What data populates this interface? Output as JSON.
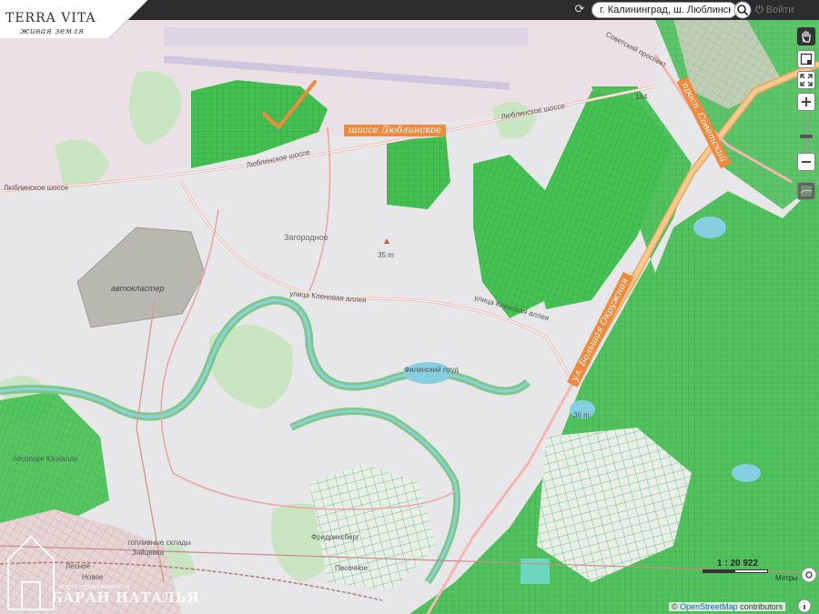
{
  "app": {
    "logo_title": "TERRA VITA",
    "logo_subtitle": "живая земля"
  },
  "header": {
    "search_value": "г. Калининград, ш. Люблинское, ",
    "logout_label": "Войти"
  },
  "map_labels": {
    "highway_lyublinskoe": "шоссе Люблинское",
    "prospect_sovetsky": "просп. Советский",
    "big_ring_road": "ул. Большая Окружная",
    "autocluster": "автокластер",
    "zagorodnoe": "Загородное",
    "elevation_35": "35 m",
    "elevation_36": "36 m",
    "street_klenovaya": "улица Кленовая аллея",
    "street_klenovaya_2": "улица Кленовая аллея",
    "lyublinskoe_road": "Люблинское шоссе",
    "lyublinskoe_road_2": "Люблинское шоссе",
    "lyublinskoe_road_3": "Люблинское шоссе",
    "filinsky_pond": "Филинский пруд",
    "forest_park": "лесопарк Юнхалле",
    "fuel_depot": "топливные склады",
    "zaitsevka": "Зайцевка",
    "friedrichsberg": "Фридрихсберг",
    "pesochnoe": "Песочное",
    "lesnoe": "Лесное",
    "novoe": "Новое",
    "road_184": "184",
    "sovetsky_prospect": "Советский проспект"
  },
  "scale": {
    "ratio": "1 : 20 922",
    "unit": "Метры"
  },
  "attribution": {
    "prefix": "©",
    "link": "OpenStreetMap",
    "suffix": "contributors"
  },
  "watermark": {
    "name": "БАРАН НАТАЛЬЯ",
    "sub": "агент недвижимости"
  },
  "colors": {
    "plots_green": "#3cb84a",
    "parcel_border": "#2f9e3c",
    "orange_label": "#f08a3c",
    "topbar": "#2c2c2e",
    "water": "#7fcde0"
  },
  "icons": {
    "refresh": "refresh-icon",
    "search": "search-icon",
    "power": "power-icon",
    "pan": "hand-icon",
    "check": "checkmark-icon"
  }
}
